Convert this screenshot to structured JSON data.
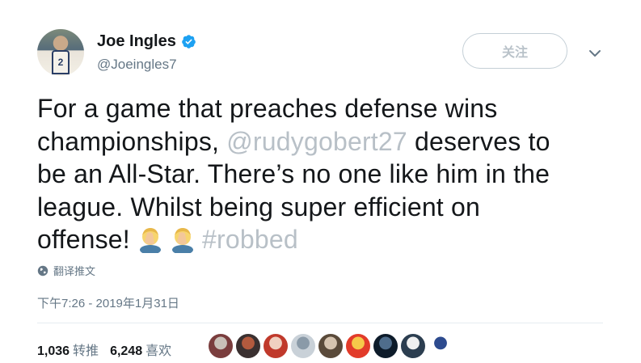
{
  "user": {
    "display_name": "Joe Ingles",
    "handle": "@Joeingles7",
    "jersey_number": "2"
  },
  "follow_button": {
    "label": "关注"
  },
  "tweet": {
    "line1": "For a game that preaches defense wins",
    "line2_prefix": "championships, ",
    "mention": "@rudygobert27",
    "line2_suffix": " deserves to",
    "line3": "be an All-Star. There’s no one like him in the",
    "line4": "league. Whilst being super efficient on",
    "line5_prefix": "offense! ",
    "hashtag": "#robbed"
  },
  "translate": {
    "label": "翻译推文"
  },
  "timestamp": "下午7:26 - 2019年1月31日",
  "stats": {
    "retweets_count": "1,036",
    "retweets_label": "转推",
    "likes_count": "6,248",
    "likes_label": "喜欢"
  },
  "colors": {
    "link": "#b8c0c7",
    "verified": "#1da1f2",
    "secondary_text": "#657786",
    "divider": "#e6ecf0"
  },
  "icons": [
    "verified-badge-icon",
    "chevron-down-icon",
    "globe-icon",
    "facepalm-emoji-icon"
  ],
  "liker_avatars": [
    {
      "colors": [
        "#7a3d3d",
        "#c9c0b8"
      ]
    },
    {
      "colors": [
        "#3a3030",
        "#b35a3e"
      ]
    },
    {
      "colors": [
        "#c0392b",
        "#f0d0c0"
      ]
    },
    {
      "colors": [
        "#c9d1d8",
        "#8a9aa8"
      ]
    },
    {
      "colors": [
        "#5a4a3a",
        "#d6c4b0"
      ]
    },
    {
      "colors": [
        "#e23b2a",
        "#f6c94a"
      ]
    },
    {
      "colors": [
        "#0d1b2a",
        "#4f6d8c"
      ]
    },
    {
      "colors": [
        "#2c3e50",
        "#f0f0f0"
      ]
    },
    {
      "colors": [
        "#ffffff",
        "#2d4b8e"
      ]
    }
  ]
}
